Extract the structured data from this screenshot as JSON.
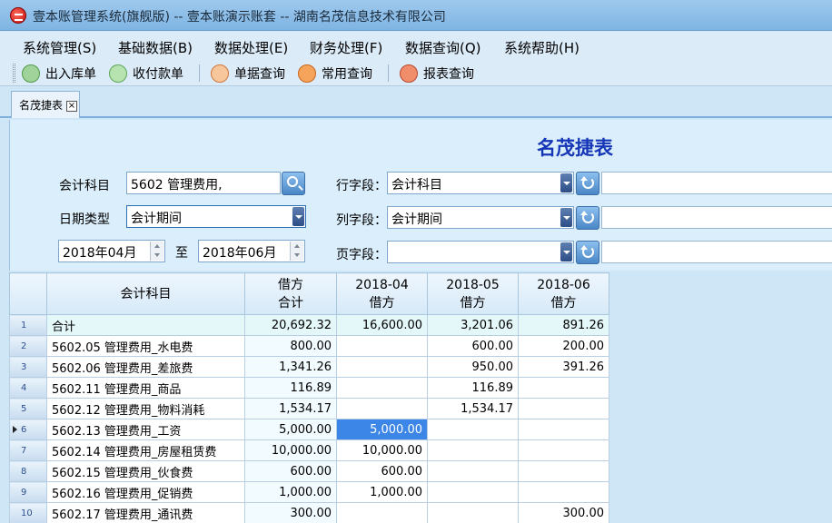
{
  "window": {
    "title": "壹本账管理系统(旗舰版) -- 壹本账演示账套 -- 湖南名茂信息技术有限公司"
  },
  "menu": [
    "系统管理(S)",
    "基础数据(B)",
    "数据处理(E)",
    "财务处理(F)",
    "数据查询(Q)",
    "系统帮助(H)"
  ],
  "toolbar": {
    "stock_label": "出入库单",
    "payment_label": "收付款单",
    "voucher_label": "单据查询",
    "common_label": "常用查询",
    "report_label": "报表查询"
  },
  "tab": {
    "label": "名茂捷表",
    "close": "×"
  },
  "form": {
    "title": "名茂捷表",
    "account_label": "会计科目",
    "account_value": "5602 管理费用,",
    "date_type_label": "日期类型",
    "date_type_value": "会计期间",
    "date_from": "2018年04月",
    "to_label": "至",
    "date_to": "2018年06月",
    "row_field_label": "行字段：",
    "row_field_value": "会计科目",
    "col_field_label": "列字段：",
    "col_field_value": "会计期间",
    "page_field_label": "页字段：",
    "page_field_value": ""
  },
  "grid": {
    "headers": {
      "account": "会计科目",
      "debit_top": "借方",
      "debit_bottom": "合计",
      "p1_top": "2018-04",
      "p1_bottom": "借方",
      "p2_top": "2018-05",
      "p2_bottom": "借方",
      "p3_top": "2018-06",
      "p3_bottom": "借方"
    },
    "rows": [
      {
        "no": "1",
        "account": "合计",
        "total": "20,692.32",
        "p1": "16,600.00",
        "p2": "3,201.06",
        "p3": "891.26"
      },
      {
        "no": "2",
        "account": "5602.05 管理费用_水电费",
        "total": "800.00",
        "p1": "",
        "p2": "600.00",
        "p3": "200.00"
      },
      {
        "no": "3",
        "account": "5602.06 管理费用_差旅费",
        "total": "1,341.26",
        "p1": "",
        "p2": "950.00",
        "p3": "391.26"
      },
      {
        "no": "4",
        "account": "5602.11 管理费用_商品",
        "total": "116.89",
        "p1": "",
        "p2": "116.89",
        "p3": ""
      },
      {
        "no": "5",
        "account": "5602.12 管理费用_物料消耗",
        "total": "1,534.17",
        "p1": "",
        "p2": "1,534.17",
        "p3": ""
      },
      {
        "no": "6",
        "account": "5602.13 管理费用_工资",
        "total": "5,000.00",
        "p1": "5,000.00",
        "p2": "",
        "p3": ""
      },
      {
        "no": "7",
        "account": "5602.14 管理费用_房屋租赁费",
        "total": "10,000.00",
        "p1": "10,000.00",
        "p2": "",
        "p3": ""
      },
      {
        "no": "8",
        "account": "5602.15 管理费用_伙食费",
        "total": "600.00",
        "p1": "600.00",
        "p2": "",
        "p3": ""
      },
      {
        "no": "9",
        "account": "5602.16 管理费用_促销费",
        "total": "1,000.00",
        "p1": "1,000.00",
        "p2": "",
        "p3": ""
      },
      {
        "no": "10",
        "account": "5602.17 管理费用_通讯费",
        "total": "300.00",
        "p1": "",
        "p2": "",
        "p3": "300.00"
      }
    ]
  }
}
